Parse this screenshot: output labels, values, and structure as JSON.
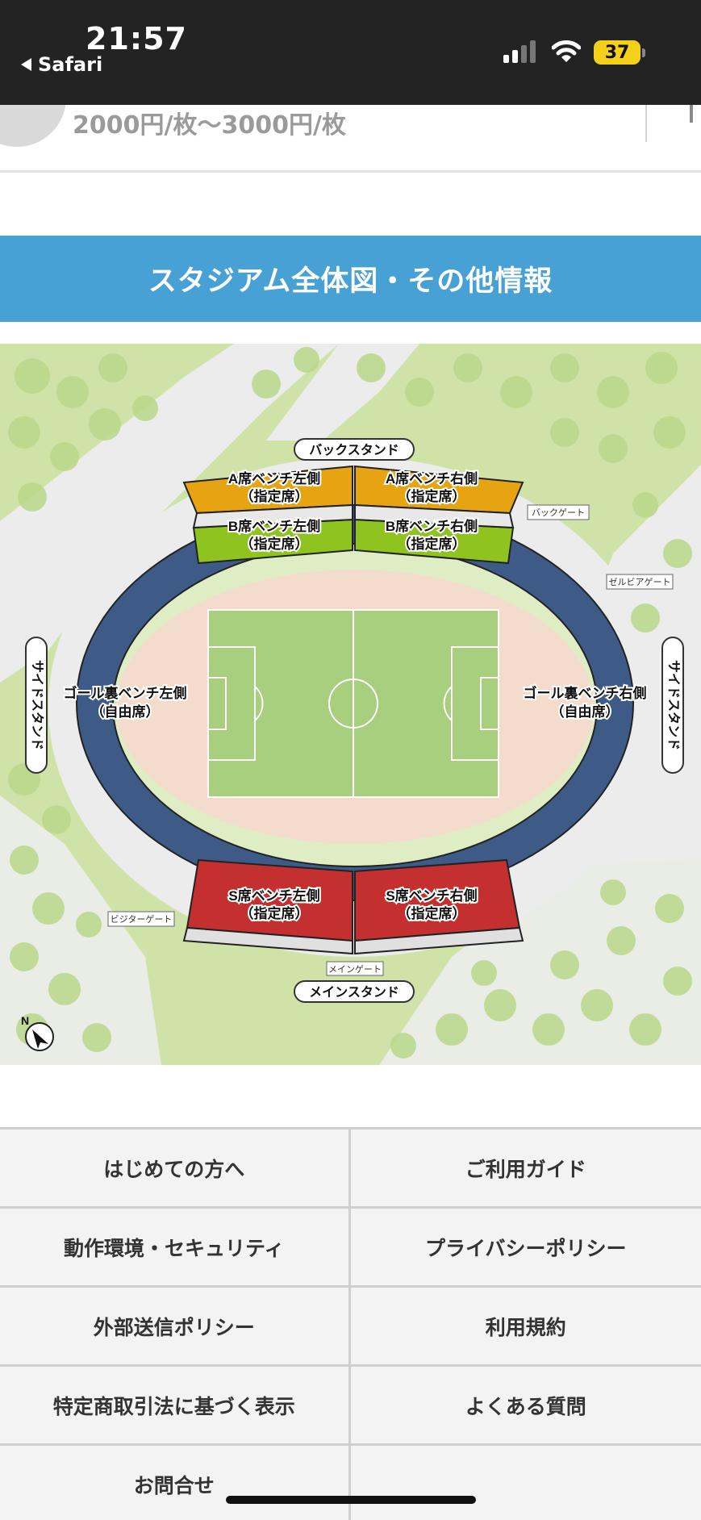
{
  "status_bar": {
    "time": "21:57",
    "back_app": "Safari",
    "battery": "37"
  },
  "ticket": {
    "price_range": "2000円/枚〜3000円/枚"
  },
  "section": {
    "title": "スタジアム全体図・その他情報"
  },
  "stadium_map": {
    "stand_labels": {
      "back": "バックスタンド",
      "main": "メインスタンド",
      "side_left": "サイドスタンド",
      "side_right": "サイドスタンド"
    },
    "gates": {
      "back": "バックゲート",
      "zelvia": "ゼルビアゲート",
      "visitor": "ビジターゲート",
      "main": "メインゲート"
    },
    "seats": {
      "a_left": [
        "A席ベンチ左側",
        "（指定席）"
      ],
      "a_right": [
        "A席ベンチ右側",
        "（指定席）"
      ],
      "b_left": [
        "B席ベンチ左側",
        "（指定席）"
      ],
      "b_right": [
        "B席ベンチ右側",
        "（指定席）"
      ],
      "goal_left": [
        "ゴール裏ベンチ左側",
        "（自由席）"
      ],
      "goal_right": [
        "ゴール裏ベンチ右側",
        "（自由席）"
      ],
      "s_left": [
        "S席ベンチ左側",
        "（指定席）"
      ],
      "s_right": [
        "S席ベンチ右側",
        "（指定席）"
      ]
    },
    "compass": "N",
    "colors": {
      "a_seats": "#e6a312",
      "b_seats": "#8fc31f",
      "goal_seats": "#3d5b86",
      "s_seats": "#c3302f",
      "track": "#f3dccb",
      "pitch": "#a7cf7e",
      "park": "#cfe3a9"
    }
  },
  "footer": {
    "links": [
      [
        "はじめての方へ",
        "ご利用ガイド"
      ],
      [
        "動作環境・セキュリティ",
        "プライバシーポリシー"
      ],
      [
        "外部送信ポリシー",
        "利用規約"
      ],
      [
        "特定商取引法に基づく表示",
        "よくある質問"
      ],
      [
        "お問合せ",
        ""
      ]
    ]
  }
}
